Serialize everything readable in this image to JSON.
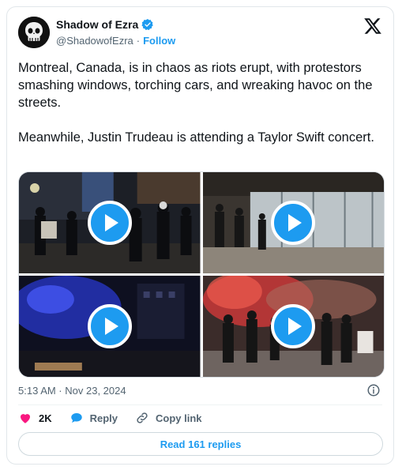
{
  "author": {
    "name": "Shadow of Ezra",
    "handle": "@ShadowofEzra",
    "separator": "·",
    "follow_label": "Follow"
  },
  "tweet": {
    "paragraphs": [
      "Montreal, Canada, is in chaos as riots erupt, with protestors smashing windows, torching cars, and wreaking havoc on the streets.",
      "Meanwhile, Justin Trudeau is attending a Taylor Swift concert."
    ],
    "timestamp": "5:13 AM · Nov 23, 2024"
  },
  "media": {
    "play_icon": "play-icon",
    "tiles": 4
  },
  "actions": {
    "like_count": "2K",
    "reply_label": "Reply",
    "copy_link_label": "Copy link"
  },
  "read_replies_label": "Read 161 replies",
  "colors": {
    "accent": "#1d9bf0",
    "like": "#f91880",
    "text": "#0f1419",
    "muted": "#536471"
  }
}
